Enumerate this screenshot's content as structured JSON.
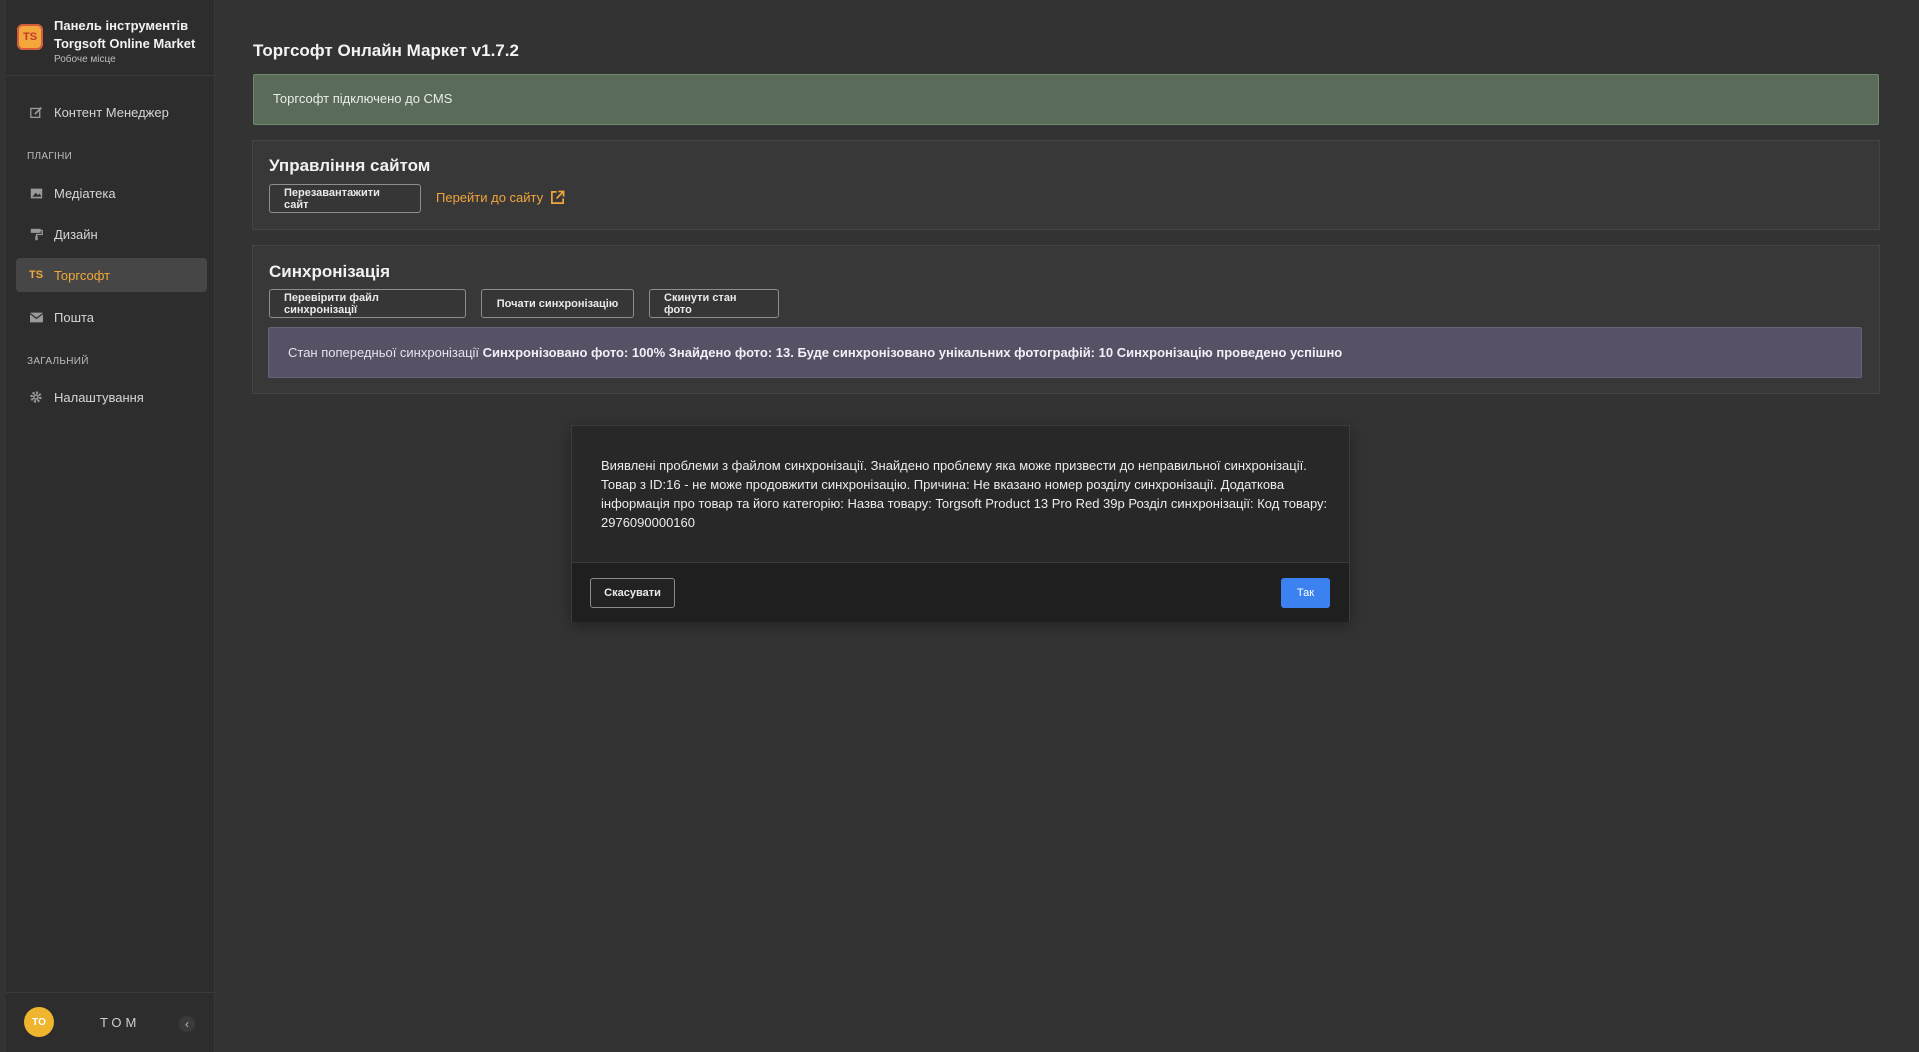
{
  "sidebar": {
    "brand_title": "Панель інструментів Torgsoft Online Market",
    "brand_subtitle": "Робоче місце",
    "brand_logo_text": "TS",
    "items": [
      {
        "label": "Контент Менеджер",
        "icon": "edit-icon"
      },
      {
        "label": "Медіатека",
        "icon": "image-icon"
      },
      {
        "label": "Дизайн",
        "icon": "paint-roller-icon"
      },
      {
        "label": "Торгсофт",
        "icon": "ts-icon",
        "icon_text": "TS",
        "active": true
      },
      {
        "label": "Пошта",
        "icon": "envelope-icon"
      },
      {
        "label": "Налаштування",
        "icon": "gear-icon"
      }
    ],
    "section_plugins": "ПЛАГІНИ",
    "section_general": "ЗАГАЛЬНИЙ",
    "user": {
      "initials": "TO",
      "name": "ТОМ"
    },
    "collapse_glyph": "‹"
  },
  "main": {
    "title": "Торгсофт Онлайн Маркет v1.7.2",
    "alert": "Торгсофт підключено до CMS",
    "site_card": {
      "title": "Управління сайтом",
      "reload_button": "Перезавантажити сайт",
      "goto_link": "Перейти до сайту"
    },
    "sync_card": {
      "title": "Синхронізація",
      "check_button": "Перевірити файл синхронізації",
      "start_button": "Почати синхронізацію",
      "reset_button": "Скинути стан фото",
      "status_prefix": "Стан попередньої синхронізації",
      "status_detail": "Синхронізовано фото: 100% Знайдено фото: 13. Буде синхронізовано унікальних фотографій: 10 Синхронізацію проведено успішно"
    }
  },
  "modal": {
    "message": "Виявлені проблеми з файлом синхронізації. Знайдено проблему яка може призвести до неправильної синхронізації. Товар з ID:16 - не може продовжити синхронізацію. Причина: Не вказано номер розділу синхронізації. Додаткова інформація про товар та його категорію: Назва товару: Torgsoft Product 13 Pro Red 39р Розділ синхронізації: Код товару: 2976090000160",
    "cancel_button": "Скасувати",
    "ok_button": "Так"
  },
  "colors": {
    "accent": "#f0a93a",
    "primary_button": "#3b82f0",
    "success_bg": "#5a6b5a",
    "info_bg": "#565165"
  }
}
